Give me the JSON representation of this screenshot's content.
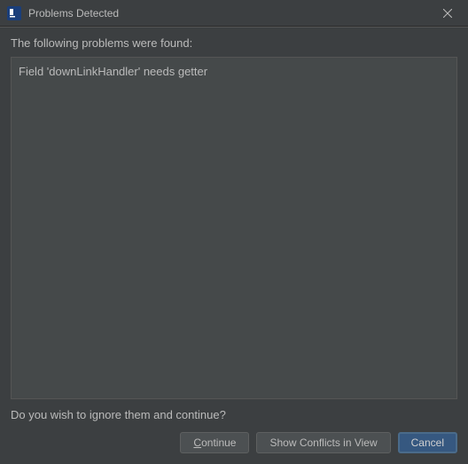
{
  "title_bar": {
    "title": "Problems Detected"
  },
  "content": {
    "intro": "The following problems were found:",
    "problems": [
      "Field 'downLinkHandler' needs getter"
    ],
    "confirm": "Do you wish to ignore them and continue?"
  },
  "buttons": {
    "continue_prefix": "C",
    "continue_rest": "ontinue",
    "show_conflicts": "Show Conflicts in View",
    "cancel": "Cancel"
  }
}
